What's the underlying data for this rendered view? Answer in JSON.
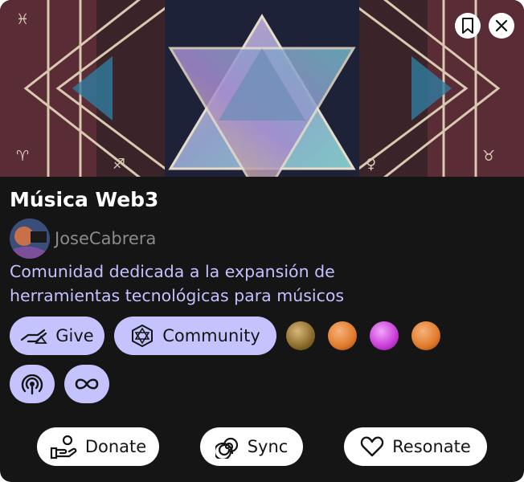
{
  "community": {
    "title": "Música Web3",
    "owner": "JoseCabrera",
    "description_lines": [
      "Comunidad dedicada a la expansión de",
      "herramientas tecnológicas para músicos"
    ]
  },
  "header_icons": {
    "bookmark": "bookmark-icon",
    "close": "close-icon"
  },
  "chips": {
    "give": "Give",
    "community": "Community"
  },
  "orbs": [
    "#8a6a2a",
    "#e07a2a",
    "#c93ad8",
    "#e07a2a"
  ],
  "actions": {
    "donate": "Donate",
    "sync": "Sync",
    "resonate": "Resonate"
  },
  "colors": {
    "card_bg": "#151515",
    "chip_bg": "#c5c3fd",
    "desc_text": "#c4c1ff"
  }
}
